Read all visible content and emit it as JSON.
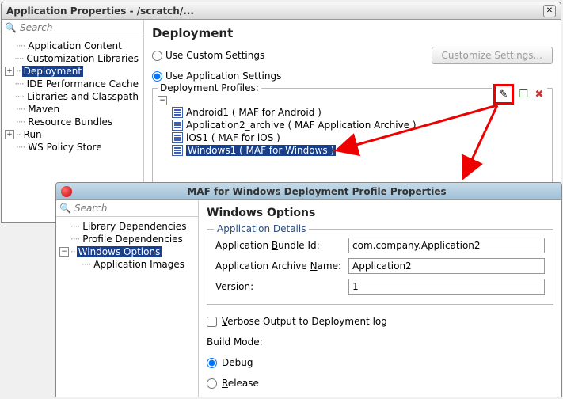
{
  "win1": {
    "title": "Application Properties - /scratch/...",
    "search_placeholder": "Search",
    "heading": "Deployment",
    "radio_custom": "Use Custom Settings",
    "radio_app": "Use Application Settings",
    "customize_btn": "Customize Settings...",
    "profiles_legend": "Deployment Profiles:",
    "tree": {
      "app_content": "Application Content",
      "cust_libs": "Customization Libraries",
      "deployment": "Deployment",
      "ide_perf": "IDE Performance Cache",
      "libs_cp": "Libraries and Classpath",
      "maven": "Maven",
      "res_bundles": "Resource Bundles",
      "run": "Run",
      "ws_policy": "WS Policy Store"
    },
    "profiles": {
      "android": "Android1 ( MAF for Android )",
      "archive": "Application2_archive ( MAF Application Archive )",
      "ios": "iOS1 ( MAF for iOS )",
      "windows": "Windows1 ( MAF for Windows )"
    }
  },
  "win2": {
    "title": "MAF for Windows Deployment Profile Properties",
    "search_placeholder": "Search",
    "heading": "Windows Options",
    "tree": {
      "lib_deps": "Library Dependencies",
      "prof_deps": "Profile Dependencies",
      "win_opts": "Windows Options",
      "app_images": "Application Images"
    },
    "fieldset_legend": "Application Details",
    "bundle_label_pre": "Application ",
    "bundle_label_u": "B",
    "bundle_label_post": "undle Id:",
    "bundle_value": "com.company.Application2",
    "archive_label_pre": "Application Archive ",
    "archive_label_u": "N",
    "archive_label_post": "ame:",
    "archive_value": "Application2",
    "version_label": "Version:",
    "version_value": "1",
    "verbose_pre": "",
    "verbose_u": "V",
    "verbose_post": "erbose Output to Deployment log",
    "build_mode": "Build Mode:",
    "debug_u": "D",
    "debug_post": "ebug",
    "release_u": "R",
    "release_post": "elease"
  }
}
